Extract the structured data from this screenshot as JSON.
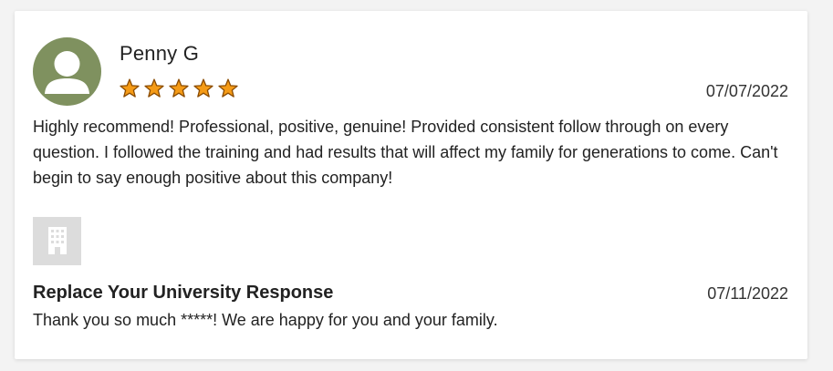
{
  "review": {
    "reviewer_name": "Penny G",
    "avatar_icon": "user-avatar-icon",
    "rating": 5,
    "rating_max": 5,
    "star_icon": "star-icon",
    "date": "07/07/2022",
    "text": "Highly recommend! Professional, positive, genuine! Provided consistent follow through on every question. I followed the training and had results that will affect my family for generations to come. Can't begin to say enough positive about this company!"
  },
  "response": {
    "logo_icon": "building-icon",
    "title": "Replace Your University Response",
    "date": "07/11/2022",
    "text": "Thank you so much *****! We are happy for you and your family."
  },
  "colors": {
    "avatar_bg": "#7f915f",
    "star_fill": "#f59b16",
    "star_stroke": "#8a4b00",
    "logo_bg": "#dcdcdc"
  }
}
